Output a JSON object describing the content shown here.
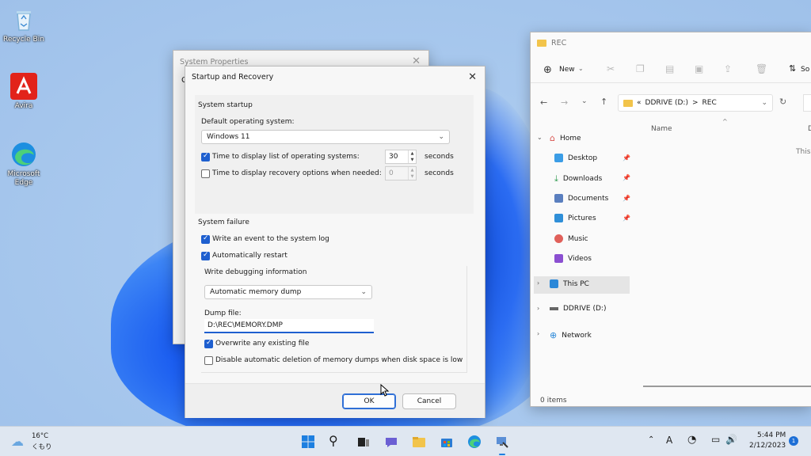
{
  "desktop": {
    "icons": [
      {
        "label": "Recycle Bin"
      },
      {
        "label": "Avira"
      },
      {
        "label": "Microsoft Edge"
      }
    ]
  },
  "system_properties": {
    "title": "System Properties",
    "peek_letter": "C"
  },
  "startup_recovery": {
    "title": "Startup and Recovery",
    "system_startup": {
      "group_label": "System startup",
      "default_os_label": "Default operating system:",
      "default_os_value": "Windows 11",
      "time_list_label": "Time to display list of operating systems:",
      "time_list_checked": true,
      "time_list_value": "30",
      "time_recovery_label": "Time to display recovery options when needed:",
      "time_recovery_checked": false,
      "time_recovery_value": "0",
      "seconds_label": "seconds"
    },
    "system_failure": {
      "group_label": "System failure",
      "write_event_label": "Write an event to the system log",
      "write_event_checked": true,
      "auto_restart_label": "Automatically restart",
      "auto_restart_checked": true,
      "debug_info_label": "Write debugging information",
      "debug_type_value": "Automatic memory dump",
      "dump_file_label": "Dump file:",
      "dump_file_value": "D:\\REC\\MEMORY.DMP",
      "overwrite_label": "Overwrite any existing file",
      "overwrite_checked": true,
      "disable_delete_label": "Disable automatic deletion of memory dumps when disk space is low",
      "disable_delete_checked": false
    },
    "ok_label": "OK",
    "cancel_label": "Cancel"
  },
  "explorer": {
    "title": "REC",
    "new_label": "New",
    "sort_label": "So",
    "path": {
      "prefix": "«",
      "drive": "DDRIVE (D:)",
      "sep": ">",
      "folder": "REC"
    },
    "column_name": "Name",
    "column_d": "D",
    "empty_text": "This",
    "nav": [
      {
        "label": "Home"
      },
      {
        "label": "Desktop"
      },
      {
        "label": "Downloads"
      },
      {
        "label": "Documents"
      },
      {
        "label": "Pictures"
      },
      {
        "label": "Music"
      },
      {
        "label": "Videos"
      },
      {
        "label": "This PC"
      },
      {
        "label": "DDRIVE (D:)"
      },
      {
        "label": "Network"
      }
    ],
    "status": "0 items"
  },
  "taskbar": {
    "weather_temp": "16°C",
    "weather_desc": "くもり",
    "ime_label": "A",
    "time": "5:44 PM",
    "date": "2/12/2023",
    "notification_count": "1"
  },
  "colors": {
    "accent": "#1e5fcf",
    "window_bg": "#f3f3f3",
    "taskbar_bg": "#dfe7f1"
  }
}
